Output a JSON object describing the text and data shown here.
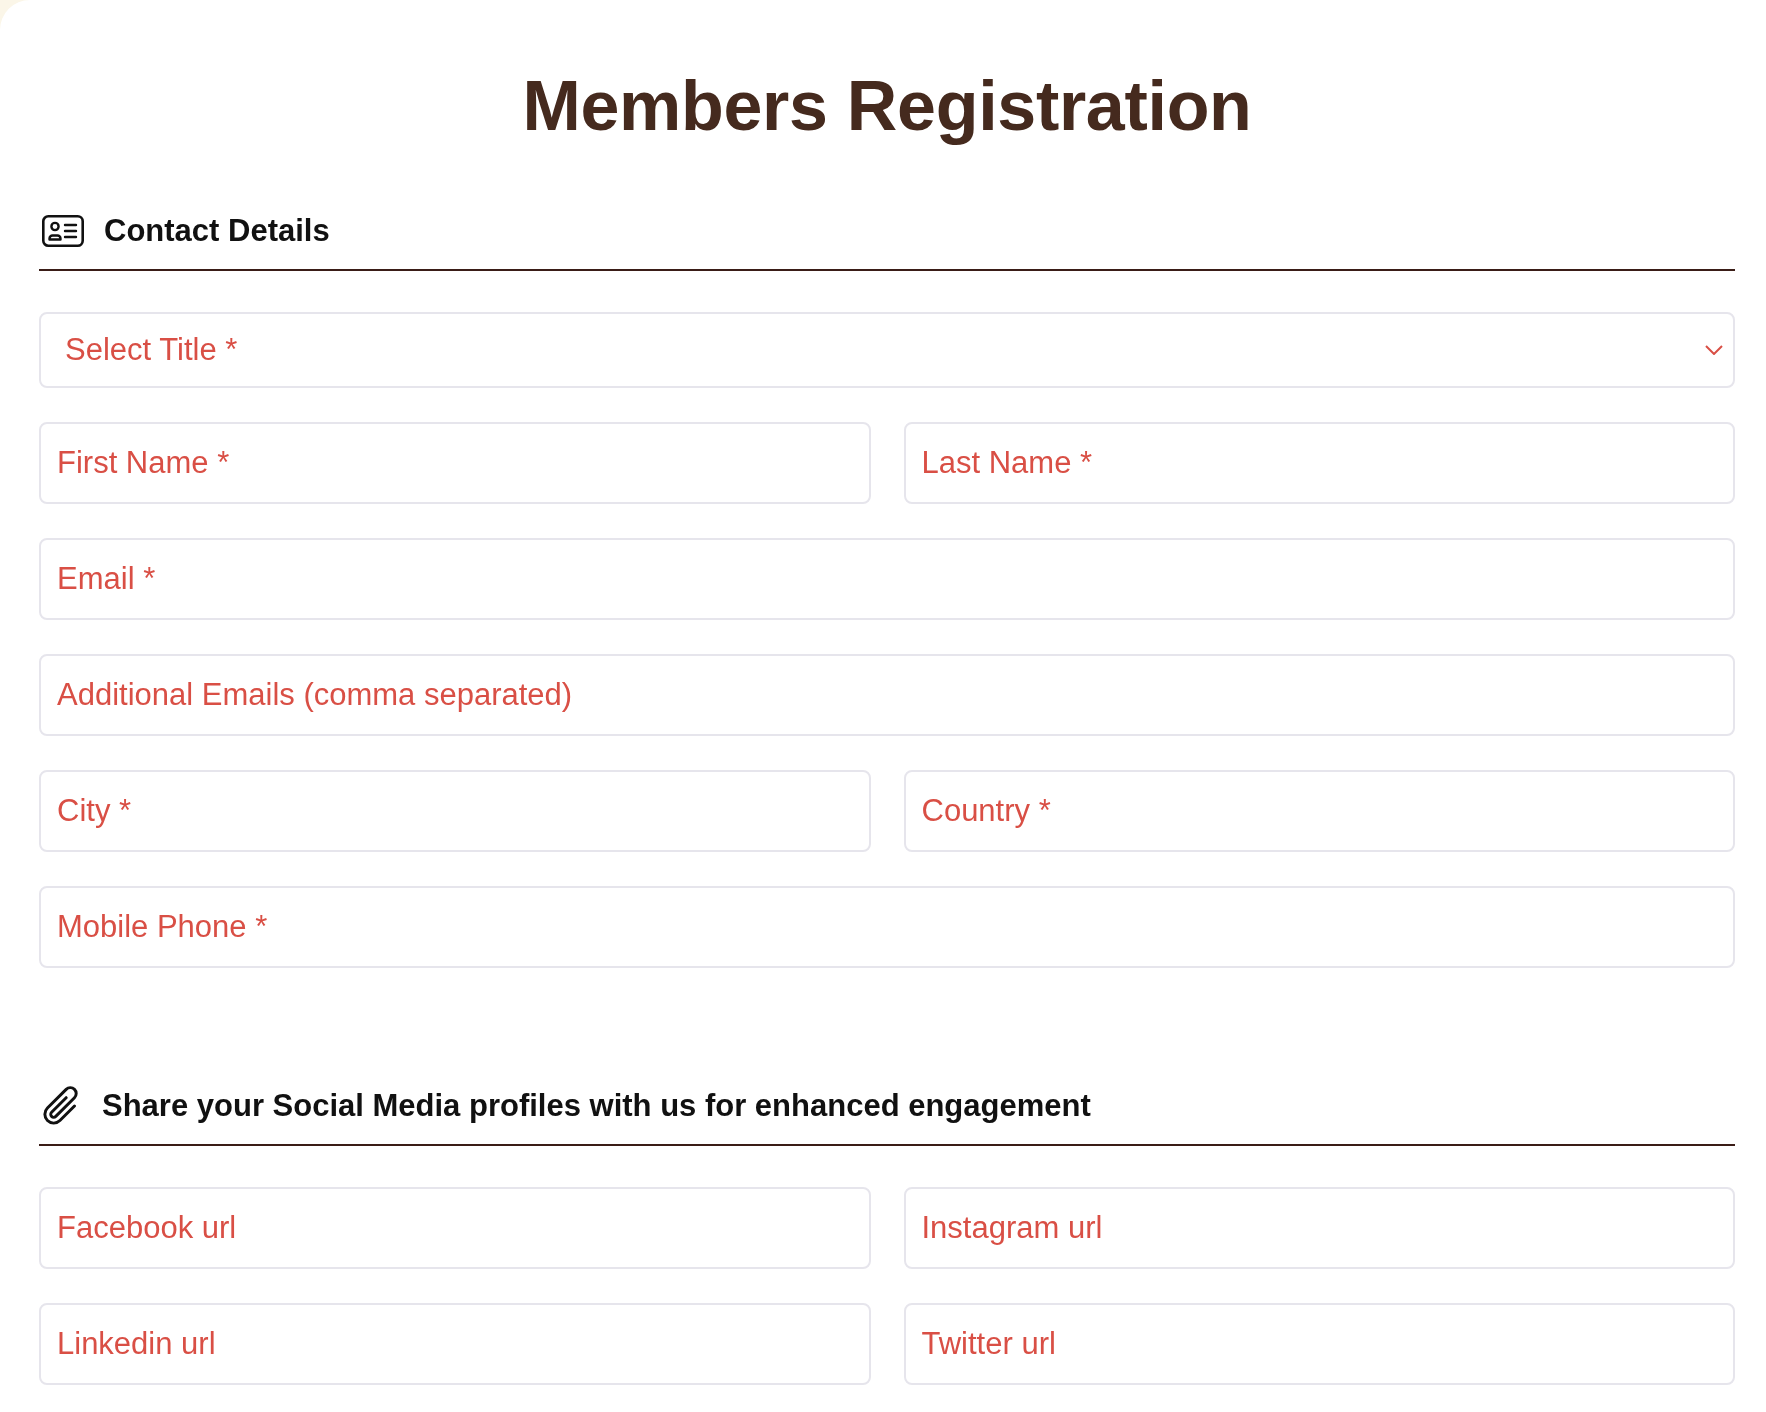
{
  "title": "Members Registration",
  "sections": [
    {
      "heading": "Contact Details",
      "rows": [
        {
          "fields": [
            {
              "kind": "select",
              "placeholder": "Select Title *"
            }
          ]
        },
        {
          "fields": [
            {
              "kind": "text",
              "placeholder": "First Name *"
            },
            {
              "kind": "text",
              "placeholder": "Last Name *"
            }
          ]
        },
        {
          "fields": [
            {
              "kind": "text",
              "placeholder": "Email *"
            }
          ]
        },
        {
          "fields": [
            {
              "kind": "text",
              "placeholder": "Additional Emails (comma separated)"
            }
          ]
        },
        {
          "fields": [
            {
              "kind": "text",
              "placeholder": "City *"
            },
            {
              "kind": "text",
              "placeholder": "Country *"
            }
          ]
        },
        {
          "fields": [
            {
              "kind": "text",
              "placeholder": "Mobile Phone *"
            }
          ]
        }
      ]
    },
    {
      "heading": "Share your Social Media profiles with us for enhanced engagement",
      "rows": [
        {
          "fields": [
            {
              "kind": "text",
              "placeholder": "Facebook url"
            },
            {
              "kind": "text",
              "placeholder": "Instagram url"
            }
          ]
        },
        {
          "fields": [
            {
              "kind": "text",
              "placeholder": "Linkedin url"
            },
            {
              "kind": "text",
              "placeholder": "Twitter url"
            }
          ]
        }
      ]
    }
  ]
}
